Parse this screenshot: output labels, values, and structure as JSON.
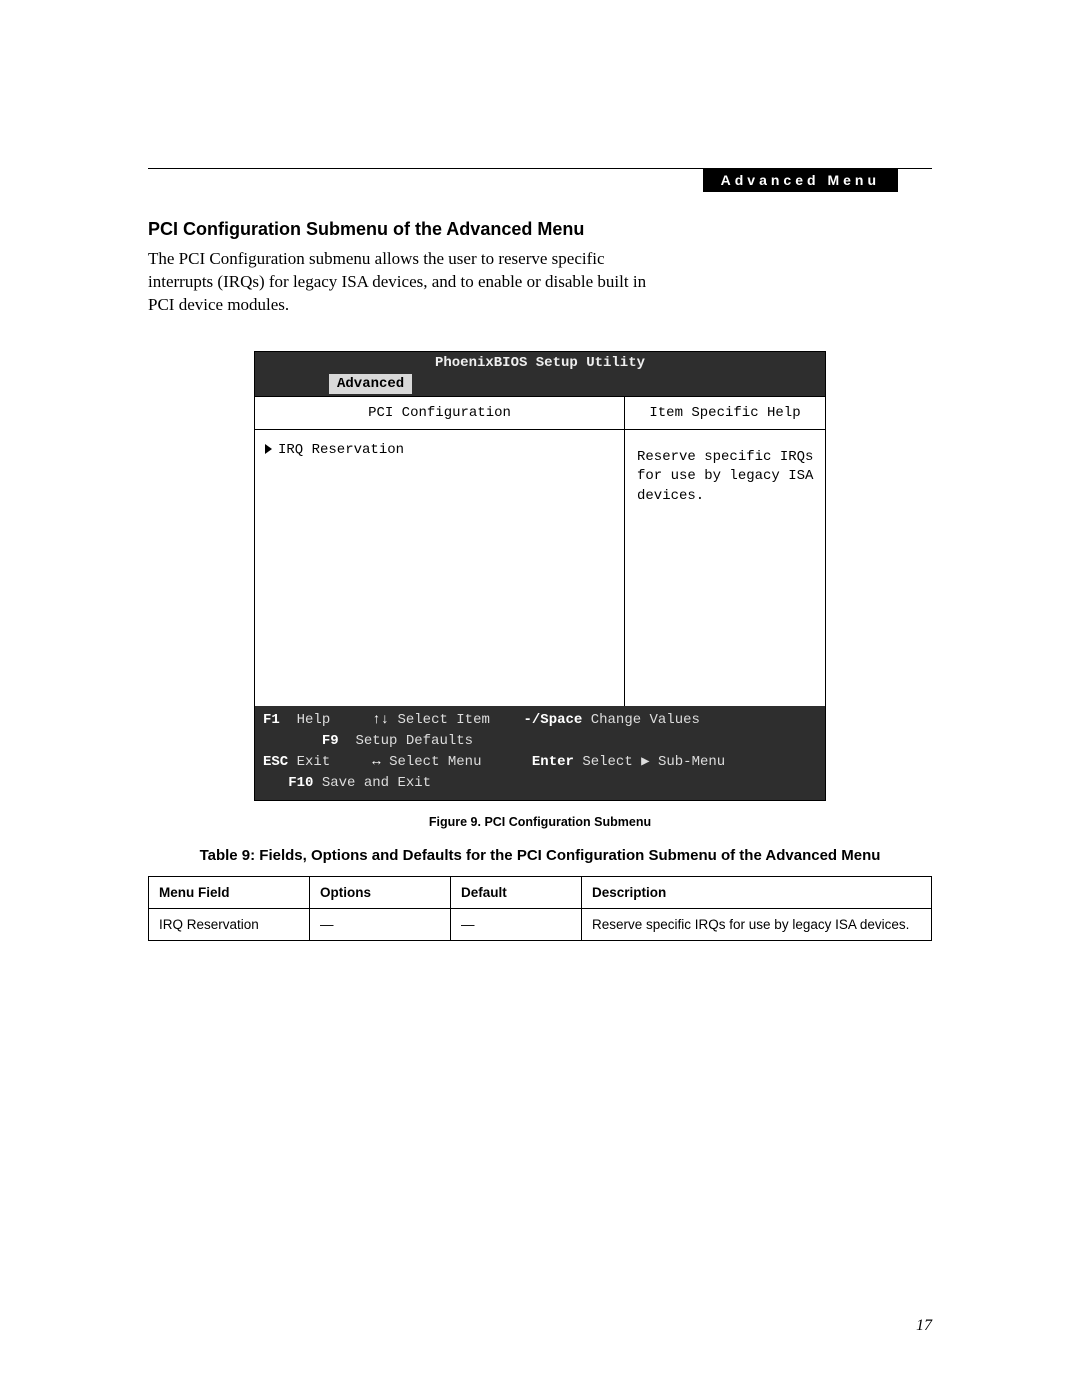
{
  "header": {
    "badge": "Advanced Menu"
  },
  "section": {
    "title": "PCI Configuration Submenu of the Advanced Menu",
    "body": "The PCI Configuration submenu allows the user to reserve specific interrupts (IRQs) for legacy ISA devices, and to enable or disable built in PCI device modules."
  },
  "bios": {
    "title": "PhoenixBIOS Setup Utility",
    "active_tab": "Advanced",
    "left_header": "PCI Configuration",
    "left_item": "IRQ Reservation",
    "right_header": "Item Specific Help",
    "right_body": "Reserve specific IRQs for use by legacy ISA devices.",
    "footer": {
      "f1": "F1",
      "f1_label": "Help",
      "updown": "↑↓",
      "updown_label": "Select Item",
      "minus": "-/Space",
      "minus_label": "Change Values",
      "f9": "F9",
      "f9_label": "Setup Defaults",
      "esc": "ESC",
      "esc_label": "Exit",
      "lr": "↔",
      "lr_label": "Select Menu",
      "enter": "Enter",
      "enter_label": "Select ▶ Sub-Menu",
      "f10": "F10",
      "f10_label": "Save and Exit"
    }
  },
  "figure_caption": "Figure 9. PCI Configuration Submenu",
  "table": {
    "title": "Table 9: Fields, Options and Defaults for  the PCI Configuration Submenu of the Advanced Menu",
    "headers": [
      "Menu Field",
      "Options",
      "Default",
      "Description"
    ],
    "rows": [
      {
        "field": "IRQ Reservation",
        "options": "—",
        "default": "—",
        "description": "Reserve specific IRQs for use by legacy ISA devices."
      }
    ]
  },
  "page_number": "17"
}
